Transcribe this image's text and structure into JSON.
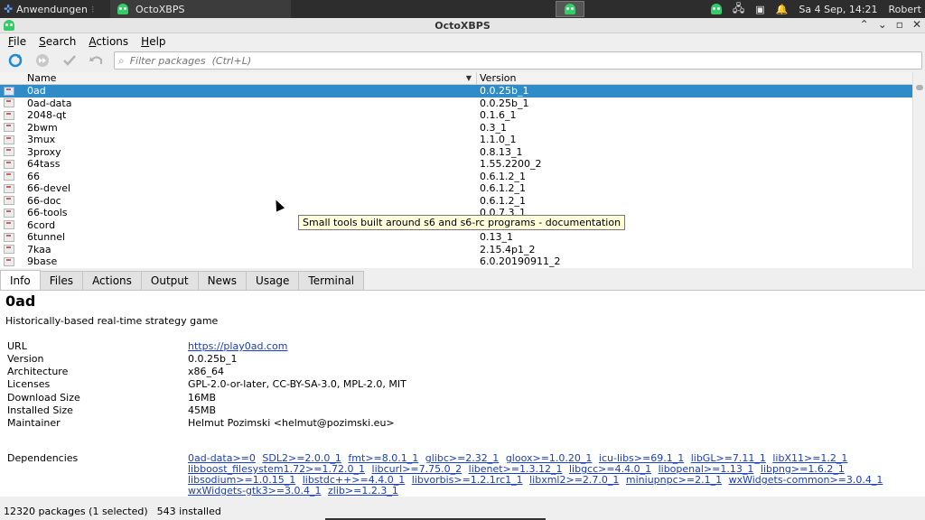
{
  "taskbar": {
    "apps_menu": "Anwendungen",
    "task_label": "OctoXBPS",
    "datetime": "Sa  4 Sep, 14:21",
    "user": "Robert"
  },
  "window": {
    "title": "OctoXBPS"
  },
  "menu": [
    {
      "label": "File"
    },
    {
      "label": "Search"
    },
    {
      "label": "Actions"
    },
    {
      "label": "Help"
    }
  ],
  "filter": {
    "placeholder": "Filter packages  (Ctrl+L)"
  },
  "table": {
    "col_name": "Name",
    "col_version": "Version",
    "rows": [
      {
        "name": "0ad",
        "version": "0.0.25b_1",
        "selected": true
      },
      {
        "name": "0ad-data",
        "version": "0.0.25b_1"
      },
      {
        "name": "2048-qt",
        "version": "0.1.6_1"
      },
      {
        "name": "2bwm",
        "version": "0.3_1"
      },
      {
        "name": "3mux",
        "version": "1.1.0_1"
      },
      {
        "name": "3proxy",
        "version": "0.8.13_1"
      },
      {
        "name": "64tass",
        "version": "1.55.2200_2"
      },
      {
        "name": "66",
        "version": "0.6.1.2_1"
      },
      {
        "name": "66-devel",
        "version": "0.6.1.2_1"
      },
      {
        "name": "66-doc",
        "version": "0.6.1.2_1"
      },
      {
        "name": "66-tools",
        "version": "0.0.7.3_1"
      },
      {
        "name": "6cord",
        "version": ""
      },
      {
        "name": "6tunnel",
        "version": "0.13_1"
      },
      {
        "name": "7kaa",
        "version": "2.15.4p1_2"
      },
      {
        "name": "9base",
        "version": "6.0.20190911_2"
      }
    ]
  },
  "tooltip": "Small tools built around s6 and s6-rc programs - documentation",
  "tabs": [
    {
      "label": "Info",
      "active": true
    },
    {
      "label": "Files"
    },
    {
      "label": "Actions"
    },
    {
      "label": "Output"
    },
    {
      "label": "News"
    },
    {
      "label": "Usage"
    },
    {
      "label": "Terminal"
    }
  ],
  "info": {
    "name": "0ad",
    "description": "Historically-based real-time strategy game",
    "fields": [
      {
        "key": "URL",
        "value": "https://play0ad.com",
        "link": true
      },
      {
        "key": "Version",
        "value": "0.0.25b_1"
      },
      {
        "key": "Architecture",
        "value": "x86_64"
      },
      {
        "key": "Licenses",
        "value": "GPL-2.0-or-later, CC-BY-SA-3.0, MPL-2.0, MIT"
      },
      {
        "key": "Download Size",
        "value": "16MB"
      },
      {
        "key": "Installed Size",
        "value": "45MB"
      },
      {
        "key": "Maintainer",
        "value": "Helmut Pozimski <helmut@pozimski.eu>"
      }
    ],
    "dependencies_label": "Dependencies",
    "dependencies": [
      "0ad-data>=0",
      "SDL2>=2.0.0_1",
      "fmt>=8.0.1_1",
      "glibc>=2.32_1",
      "gloox>=1.0.20_1",
      "icu-libs>=69.1_1",
      "libGL>=7.11_1",
      "libX11>=1.2_1",
      "libboost_filesystem1.72>=1.72.0_1",
      "libcurl>=7.75.0_2",
      "libenet>=1.3.12_1",
      "libgcc>=4.4.0_1",
      "libopenal>=1.13_1",
      "libpng>=1.6.2_1",
      "libsodium>=1.0.15_1",
      "libstdc++>=4.4.0_1",
      "libvorbis>=1.2.1rc1_1",
      "libxml2>=2.7.0_1",
      "miniupnpc>=2.1_1",
      "wxWidgets-common>=3.0.4_1",
      "wxWidgets-gtk3>=3.0.4_1",
      "zlib>=1.2.3_1"
    ]
  },
  "status": {
    "packages": "12320 packages (1 selected)",
    "installed": "543 installed"
  }
}
